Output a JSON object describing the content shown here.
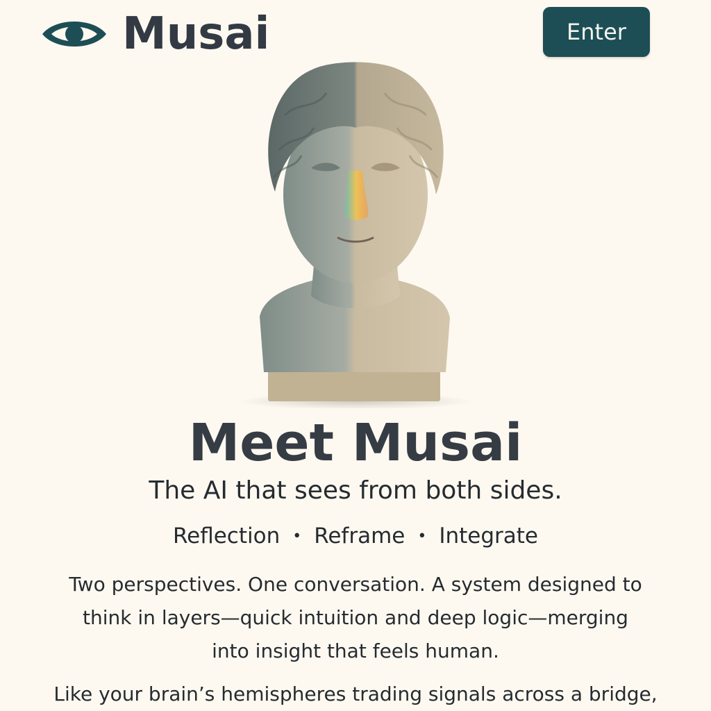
{
  "header": {
    "brand_name": "Musai",
    "logo_icon": "eye-icon",
    "enter_label": "Enter"
  },
  "hero": {
    "image": "split-tone-marble-bust"
  },
  "content": {
    "headline": "Meet Musai",
    "tagline": "The AI that sees from both sides.",
    "pillars": [
      "Reflection",
      "Reframe",
      "Integrate"
    ],
    "pillar_separator": "•",
    "body_lines": [
      "Two perspectives. One conversation. A system designed to",
      "think in layers—quick intuition and deep logic—merging",
      "into insight that feels human."
    ],
    "body_2": "Like your brain’s hemispheres trading signals across a bridge,"
  },
  "colors": {
    "accent": "#1d4e55",
    "background": "#fdf9f0",
    "text": "#333a44"
  }
}
